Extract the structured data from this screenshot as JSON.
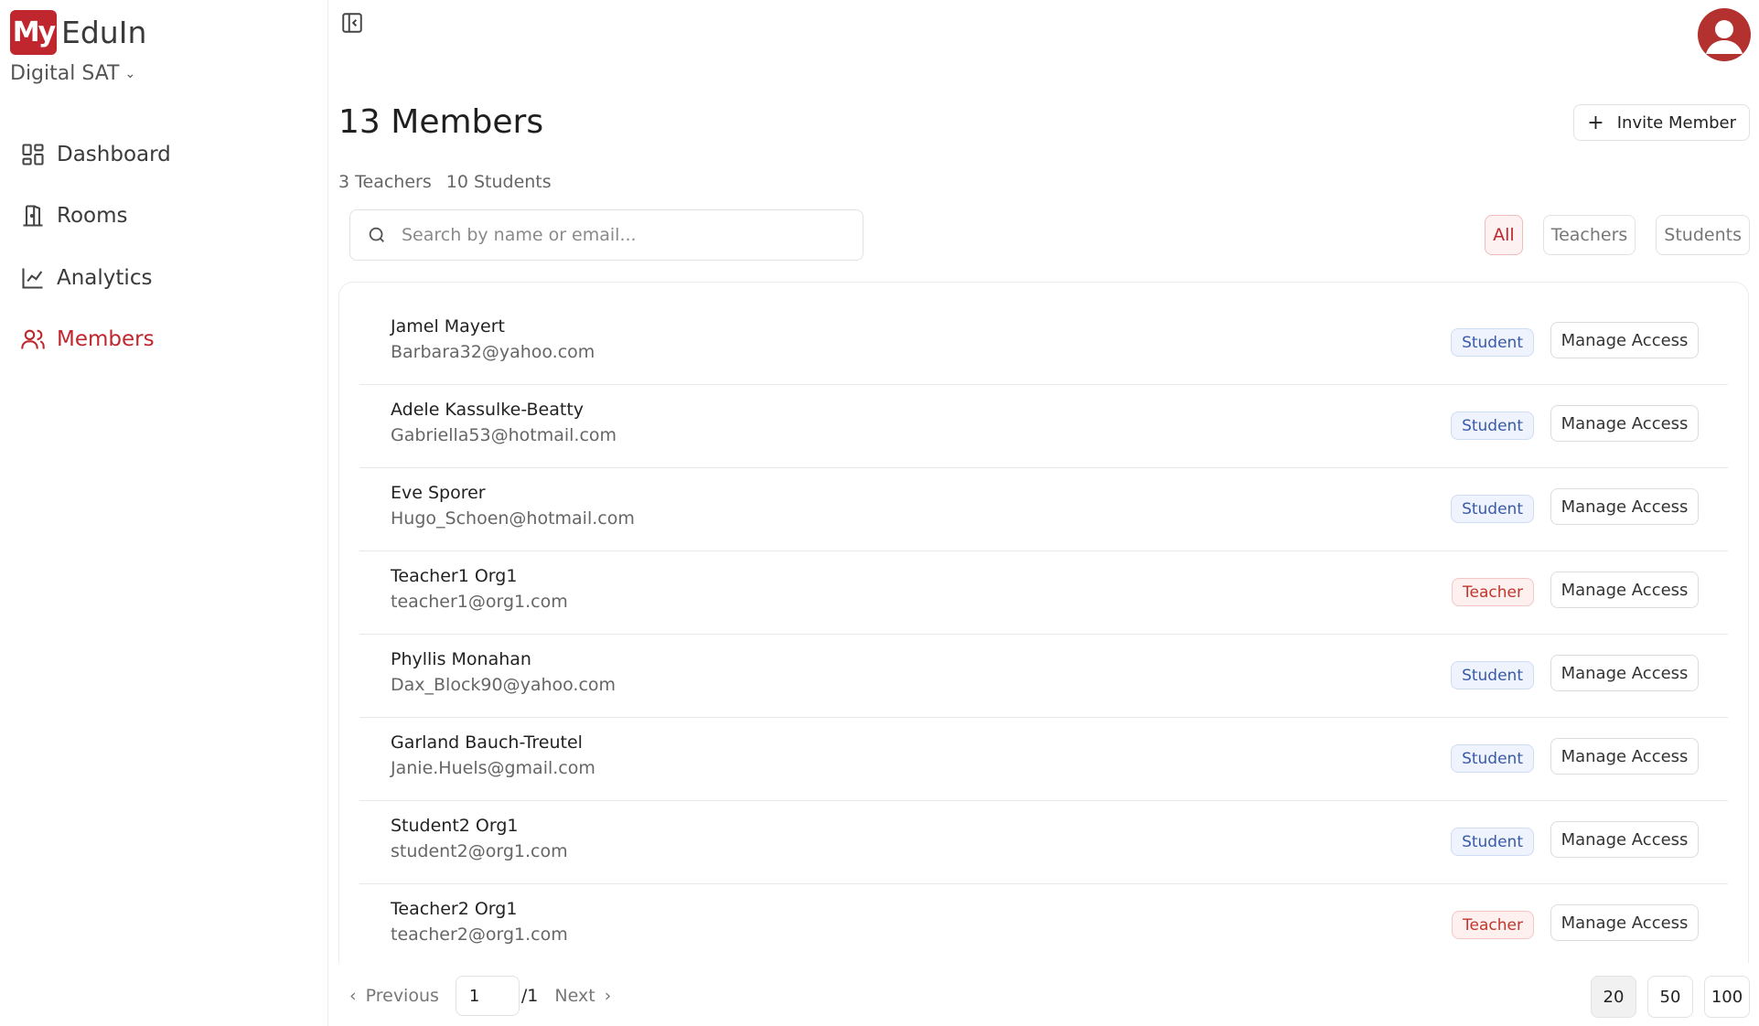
{
  "brand": {
    "logo_text": "My",
    "name": "EduIn"
  },
  "org": {
    "selected": "Digital SAT"
  },
  "nav": [
    {
      "label": "Dashboard",
      "icon": "dashboard-icon"
    },
    {
      "label": "Rooms",
      "icon": "door-icon"
    },
    {
      "label": "Analytics",
      "icon": "chart-line-icon"
    },
    {
      "label": "Members",
      "icon": "users-icon",
      "active": true
    }
  ],
  "page": {
    "title": "13 Members",
    "invite_label": "Invite Member",
    "counts": {
      "teachers": "3 Teachers",
      "students": "10 Students"
    },
    "search_placeholder": "Search by name or email...",
    "filters": {
      "all": "All",
      "teachers": "Teachers",
      "students": "Students"
    }
  },
  "members": [
    {
      "name": "Jamel Mayert",
      "email": "Barbara32@yahoo.com",
      "role": "Student",
      "action": "Manage Access"
    },
    {
      "name": "Adele Kassulke-Beatty",
      "email": "Gabriella53@hotmail.com",
      "role": "Student",
      "action": "Manage Access"
    },
    {
      "name": "Eve Sporer",
      "email": "Hugo_Schoen@hotmail.com",
      "role": "Student",
      "action": "Manage Access"
    },
    {
      "name": "Teacher1 Org1",
      "email": "teacher1@org1.com",
      "role": "Teacher",
      "action": "Manage Access"
    },
    {
      "name": "Phyllis Monahan",
      "email": "Dax_Block90@yahoo.com",
      "role": "Student",
      "action": "Manage Access"
    },
    {
      "name": "Garland Bauch-Treutel",
      "email": "Janie.Huels@gmail.com",
      "role": "Student",
      "action": "Manage Access"
    },
    {
      "name": "Student2 Org1",
      "email": "student2@org1.com",
      "role": "Student",
      "action": "Manage Access"
    },
    {
      "name": "Teacher2 Org1",
      "email": "teacher2@org1.com",
      "role": "Teacher",
      "action": "Manage Access"
    }
  ],
  "pagination": {
    "previous": "Previous",
    "current_page": "1",
    "total": "/1",
    "next": "Next",
    "sizes": [
      "20",
      "50",
      "100"
    ],
    "selected_size": "20"
  },
  "colors": {
    "accent": "#c0262d",
    "student_badge": "#3a5aa8",
    "teacher_badge": "#c0362d"
  }
}
